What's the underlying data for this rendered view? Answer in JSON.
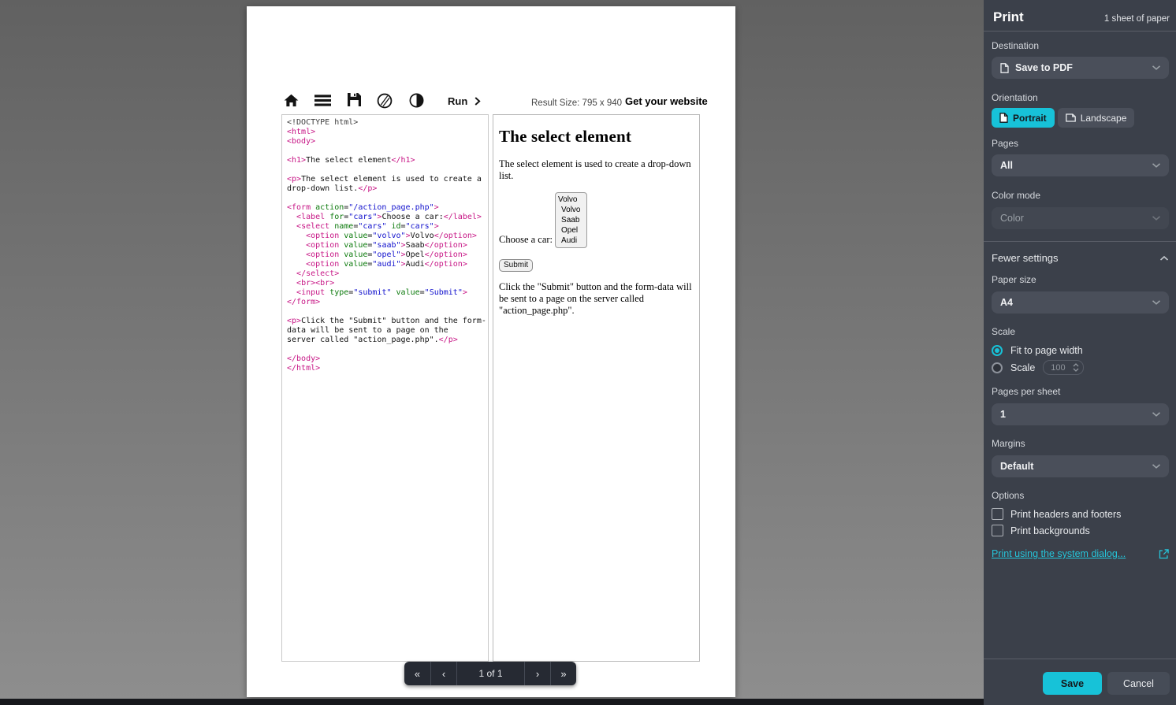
{
  "colors": {
    "accent": "#17c2d8",
    "sidebar_bg": "#3b404a",
    "preview_bg": "#7a7a7a",
    "code_tag": "#c71585",
    "code_attribute": "#0c7a0c",
    "code_string": "#1111cd"
  },
  "print_panel": {
    "title": "Print",
    "sheet_count": "1 sheet of paper",
    "destination": {
      "label": "Destination",
      "value": "Save to PDF"
    },
    "orientation": {
      "label": "Orientation",
      "portrait": "Portrait",
      "landscape": "Landscape",
      "selected": "Portrait"
    },
    "pages": {
      "label": "Pages",
      "value": "All"
    },
    "color_mode": {
      "label": "Color mode",
      "value": "Color"
    },
    "fewer_settings_label": "Fewer settings",
    "paper_size": {
      "label": "Paper size",
      "value": "A4"
    },
    "scale": {
      "label": "Scale",
      "fit_option": "Fit to page width",
      "scale_option": "Scale",
      "scale_value": "100",
      "selected": "Fit to page width"
    },
    "pages_per_sheet": {
      "label": "Pages per sheet",
      "value": "1"
    },
    "margins": {
      "label": "Margins",
      "value": "Default"
    },
    "options": {
      "label": "Options",
      "headers_footers": "Print headers and footers",
      "backgrounds": "Print backgrounds",
      "headers_footers_checked": false,
      "backgrounds_checked": false
    },
    "system_dialog_link": "Print using the system dialog...",
    "save_button": "Save",
    "cancel_button": "Cancel"
  },
  "preview": {
    "toolbar": {
      "icons": [
        "home-icon",
        "menu-icon",
        "save-icon",
        "circle-slash-icon",
        "contrast-icon"
      ],
      "run_label": "Run",
      "result_size": "Result Size: 795 x 940",
      "get_website": "Get your website"
    },
    "code": {
      "lines": [
        [
          [
            "d",
            "<!DOCTYPE html>"
          ]
        ],
        [
          [
            "t",
            "<html>"
          ]
        ],
        [
          [
            "t",
            "<body>"
          ]
        ],
        [],
        [
          [
            "t",
            "<h1>"
          ],
          [
            "x",
            "The select element"
          ],
          [
            "t",
            "</h1>"
          ]
        ],
        [],
        [
          [
            "t",
            "<p>"
          ],
          [
            "x",
            "The select element is used to create a"
          ]
        ],
        [
          [
            "x",
            "drop-down list."
          ],
          [
            "t",
            "</p>"
          ]
        ],
        [],
        [
          [
            "t",
            "<form "
          ],
          [
            "a",
            "action"
          ],
          [
            "x",
            "="
          ],
          [
            "s",
            "\"/action_page.php\""
          ],
          [
            "t",
            ">"
          ]
        ],
        [
          [
            "x",
            "  "
          ],
          [
            "t",
            "<label "
          ],
          [
            "a",
            "for"
          ],
          [
            "x",
            "="
          ],
          [
            "s",
            "\"cars\""
          ],
          [
            "t",
            ">"
          ],
          [
            "x",
            "Choose a car:"
          ],
          [
            "t",
            "</label>"
          ]
        ],
        [
          [
            "x",
            "  "
          ],
          [
            "t",
            "<select "
          ],
          [
            "a",
            "name"
          ],
          [
            "x",
            "="
          ],
          [
            "s",
            "\"cars\""
          ],
          [
            "x",
            " "
          ],
          [
            "a",
            "id"
          ],
          [
            "x",
            "="
          ],
          [
            "s",
            "\"cars\""
          ],
          [
            "t",
            ">"
          ]
        ],
        [
          [
            "x",
            "    "
          ],
          [
            "t",
            "<option "
          ],
          [
            "a",
            "value"
          ],
          [
            "x",
            "="
          ],
          [
            "s",
            "\"volvo\""
          ],
          [
            "t",
            ">"
          ],
          [
            "x",
            "Volvo"
          ],
          [
            "t",
            "</option>"
          ]
        ],
        [
          [
            "x",
            "    "
          ],
          [
            "t",
            "<option "
          ],
          [
            "a",
            "value"
          ],
          [
            "x",
            "="
          ],
          [
            "s",
            "\"saab\""
          ],
          [
            "t",
            ">"
          ],
          [
            "x",
            "Saab"
          ],
          [
            "t",
            "</option>"
          ]
        ],
        [
          [
            "x",
            "    "
          ],
          [
            "t",
            "<option "
          ],
          [
            "a",
            "value"
          ],
          [
            "x",
            "="
          ],
          [
            "s",
            "\"opel\""
          ],
          [
            "t",
            ">"
          ],
          [
            "x",
            "Opel"
          ],
          [
            "t",
            "</option>"
          ]
        ],
        [
          [
            "x",
            "    "
          ],
          [
            "t",
            "<option "
          ],
          [
            "a",
            "value"
          ],
          [
            "x",
            "="
          ],
          [
            "s",
            "\"audi\""
          ],
          [
            "t",
            ">"
          ],
          [
            "x",
            "Audi"
          ],
          [
            "t",
            "</option>"
          ]
        ],
        [
          [
            "x",
            "  "
          ],
          [
            "t",
            "</select>"
          ]
        ],
        [
          [
            "x",
            "  "
          ],
          [
            "t",
            "<br><br>"
          ]
        ],
        [
          [
            "x",
            "  "
          ],
          [
            "t",
            "<input "
          ],
          [
            "a",
            "type"
          ],
          [
            "x",
            "="
          ],
          [
            "s",
            "\"submit\""
          ],
          [
            "x",
            " "
          ],
          [
            "a",
            "value"
          ],
          [
            "x",
            "="
          ],
          [
            "s",
            "\"Submit\""
          ],
          [
            "t",
            ">"
          ]
        ],
        [
          [
            "t",
            "</form>"
          ]
        ],
        [],
        [
          [
            "t",
            "<p>"
          ],
          [
            "x",
            "Click the \"Submit\" button and the form-"
          ]
        ],
        [
          [
            "x",
            "data will be sent to a page on the"
          ]
        ],
        [
          [
            "x",
            "server called \"action_page.php\"."
          ],
          [
            "t",
            "</p>"
          ]
        ],
        [],
        [
          [
            "t",
            "</body>"
          ]
        ],
        [
          [
            "t",
            "</html>"
          ]
        ]
      ]
    },
    "output": {
      "heading": "The select element",
      "intro": "The select element is used to create a drop-down list.",
      "car_label": "Choose a car:",
      "select_display": "Volvo",
      "select_options": [
        "Volvo",
        "Saab",
        "Opel",
        "Audi"
      ],
      "submit_label": "Submit",
      "note": "Click the \"Submit\" button and the form-data will be sent to a page on the server called \"action_page.php\"."
    },
    "pagination": {
      "first": "«",
      "prev": "‹",
      "label": "1 of 1",
      "next": "›",
      "last": "»"
    }
  }
}
